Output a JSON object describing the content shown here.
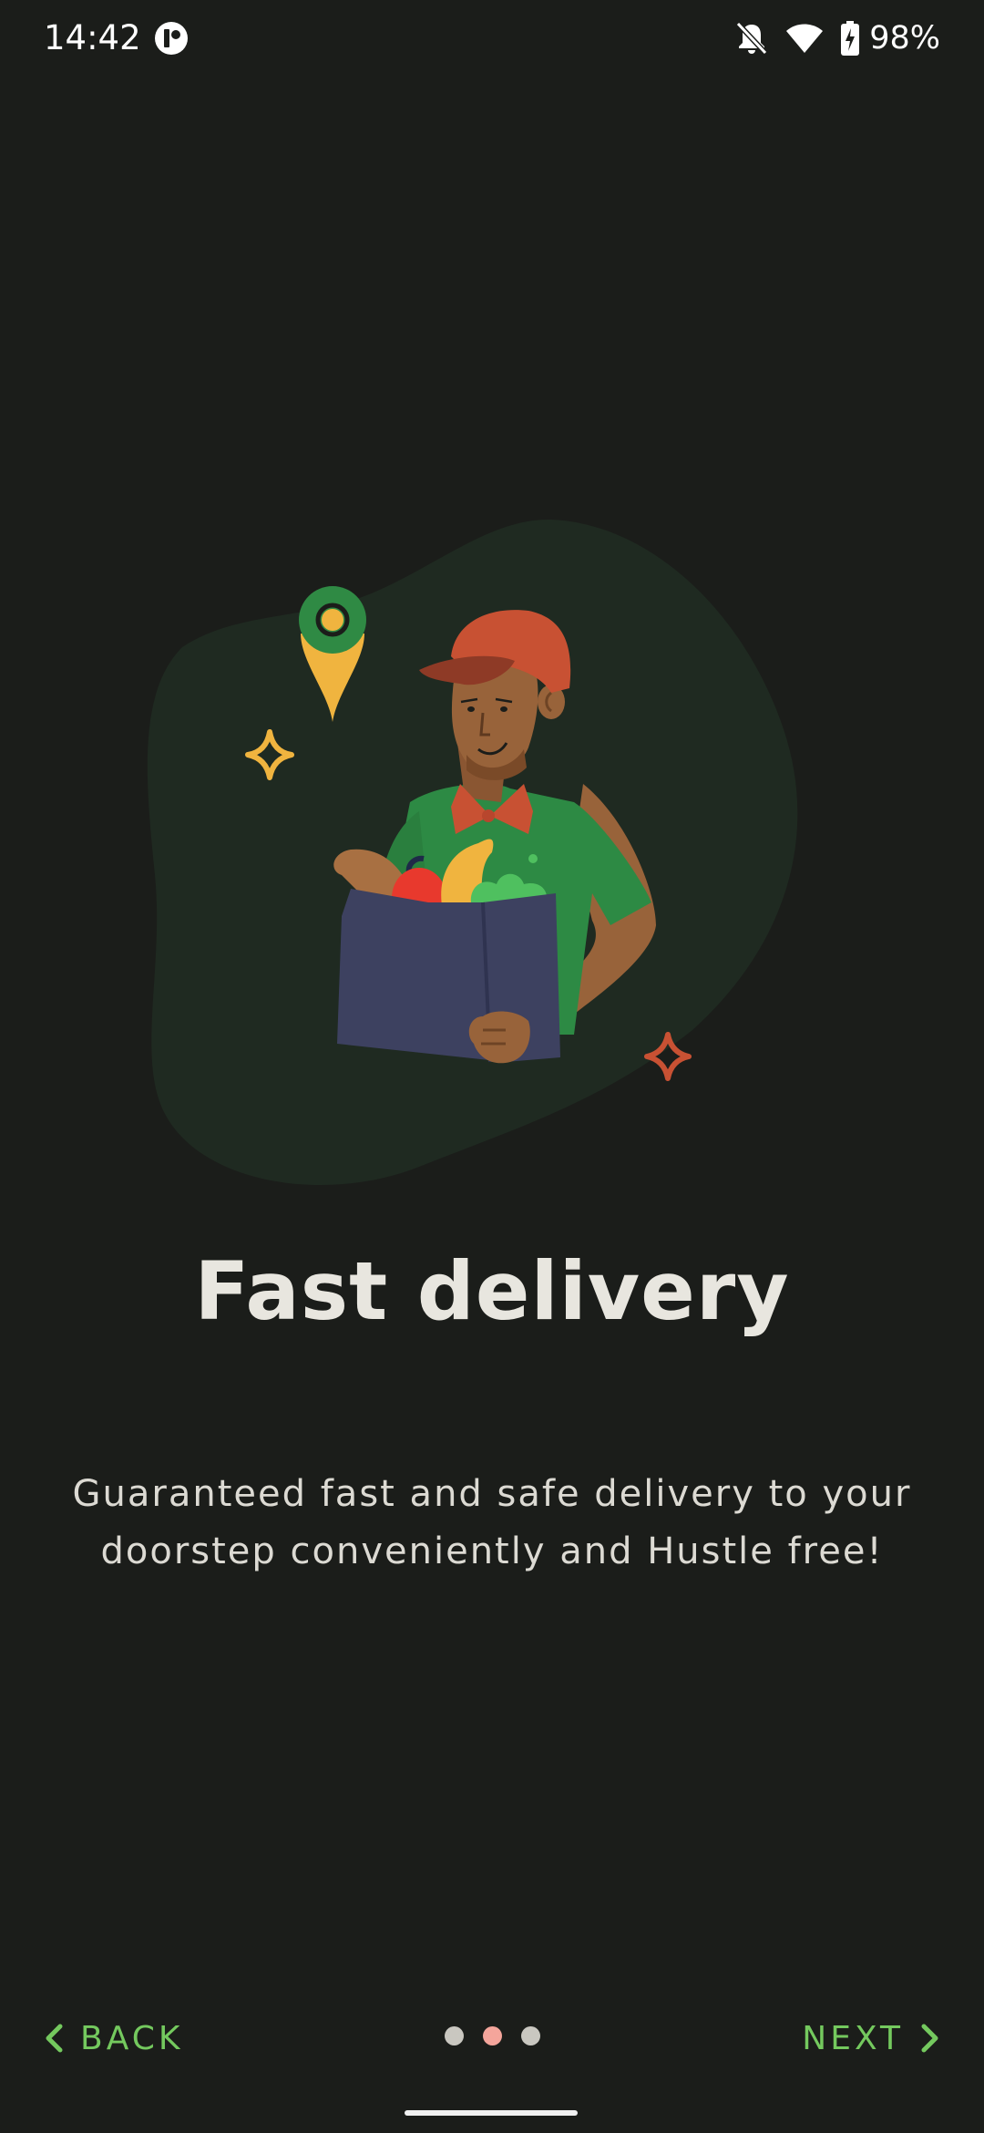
{
  "status_bar": {
    "time": "14:42",
    "battery": "98%",
    "icons": [
      "app-notification-icon",
      "bell-off-icon",
      "wifi-icon",
      "battery-charging-icon"
    ]
  },
  "onboarding": {
    "title": "Fast delivery",
    "description_line1": "Guaranteed fast and safe delivery to your",
    "description_line2": "doorstep conveniently and Hustle free!",
    "illustration": "delivery-person-with-grocery-bag"
  },
  "navigation": {
    "back_label": "BACK",
    "next_label": "NEXT",
    "page_count": 3,
    "current_page": 2
  },
  "colors": {
    "background": "#1b1d1a",
    "accent": "#74c95e",
    "active_dot": "#f4a59b",
    "inactive_dot": "#c9c7c0",
    "title_text": "#e8e6df"
  }
}
